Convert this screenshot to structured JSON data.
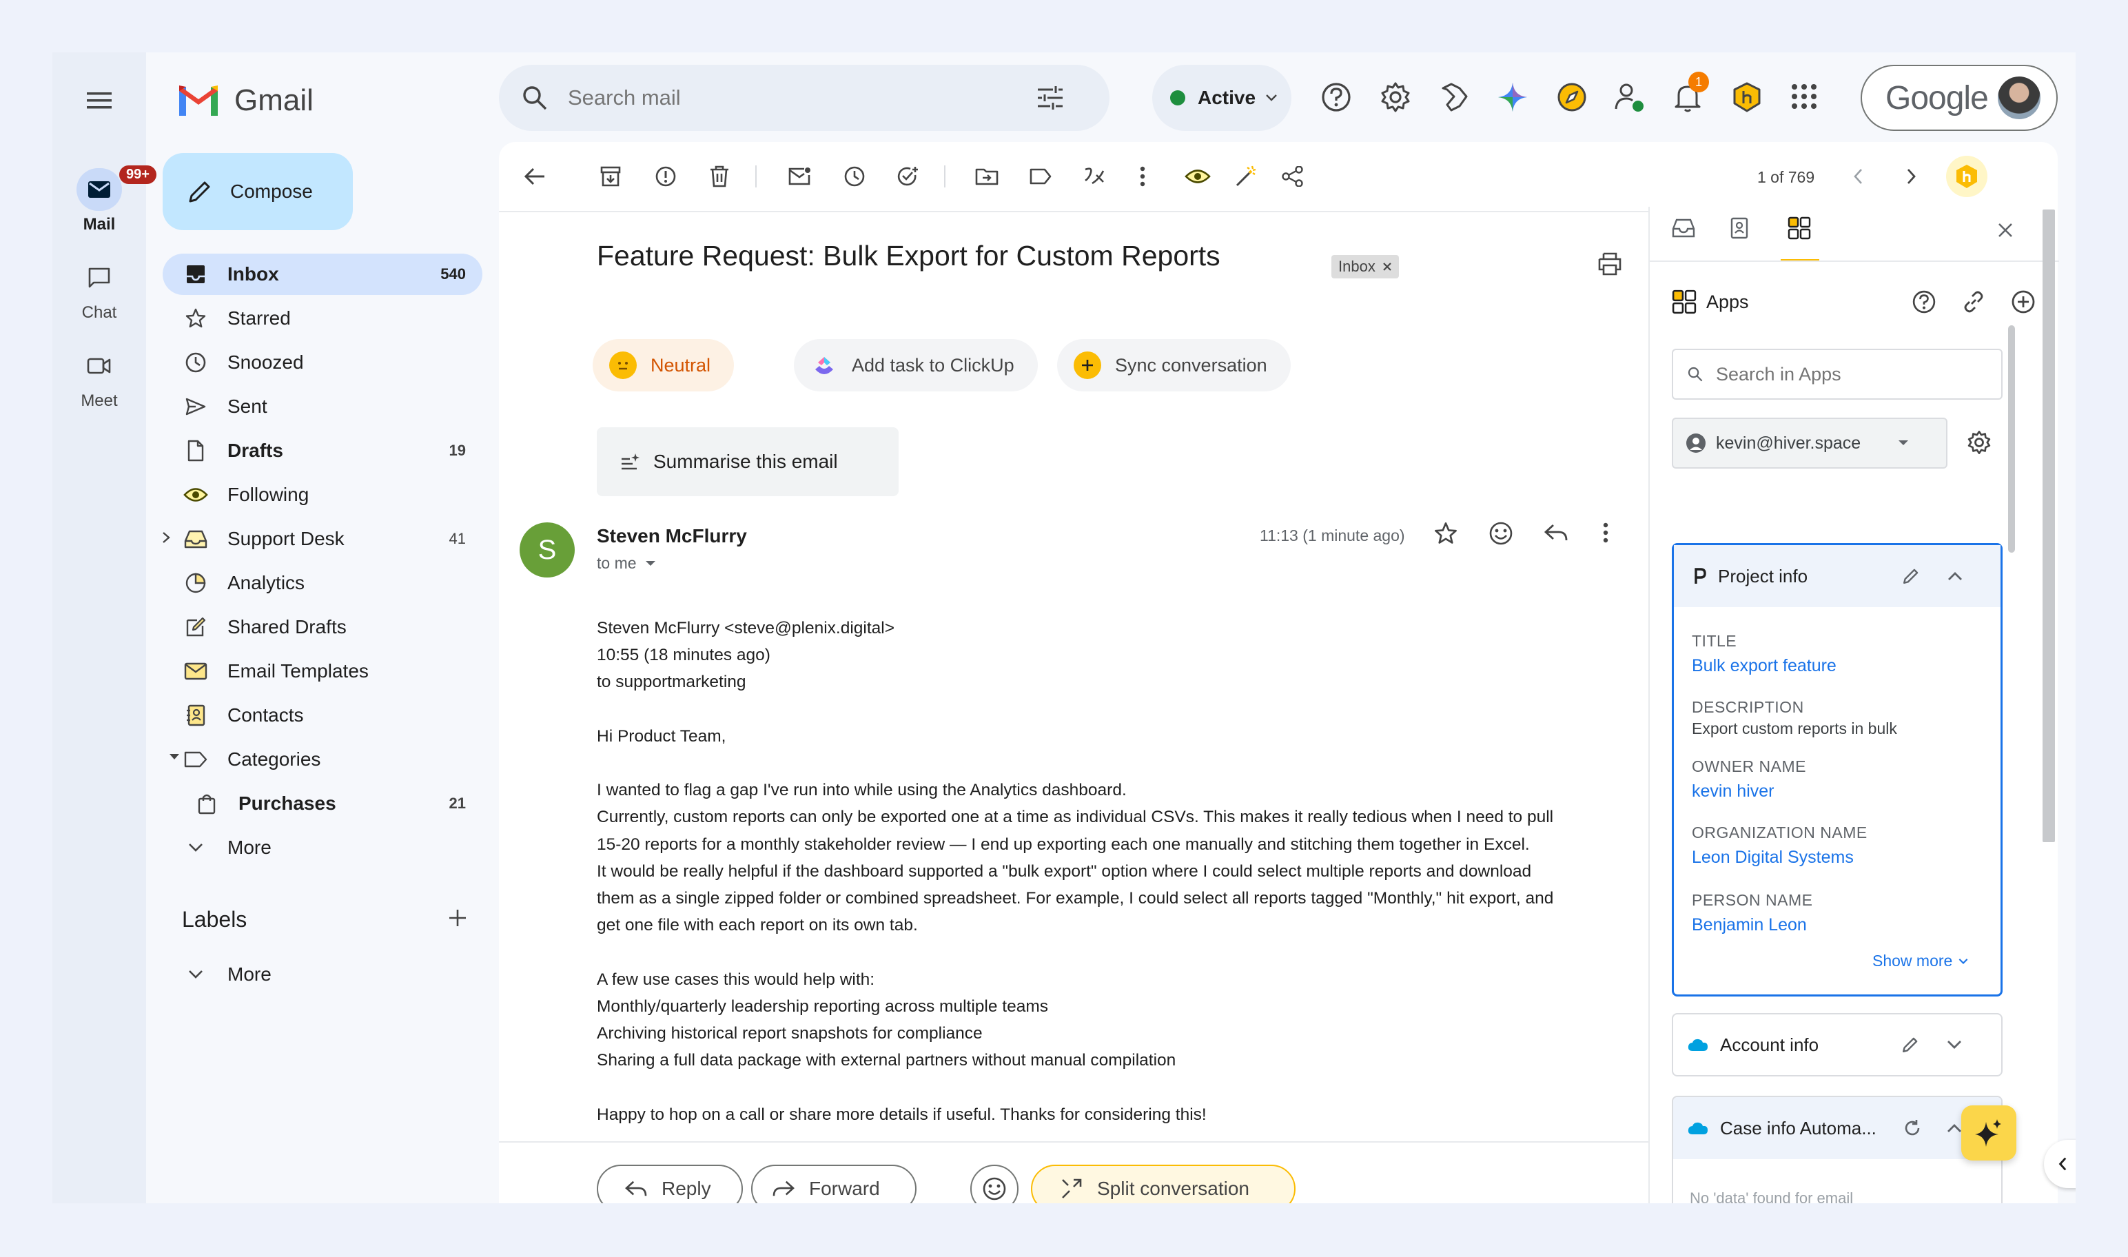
{
  "rail": {
    "mail_label": "Mail",
    "mail_badge": "99+",
    "chat_label": "Chat",
    "meet_label": "Meet"
  },
  "brand": {
    "name": "Gmail"
  },
  "compose": {
    "label": "Compose"
  },
  "nav": {
    "items": [
      {
        "label": "Inbox",
        "count": "540"
      },
      {
        "label": "Starred",
        "count": ""
      },
      {
        "label": "Snoozed",
        "count": ""
      },
      {
        "label": "Sent",
        "count": ""
      },
      {
        "label": "Drafts",
        "count": "19"
      },
      {
        "label": "Following",
        "count": ""
      },
      {
        "label": "Support Desk",
        "count": "41"
      },
      {
        "label": "Analytics",
        "count": ""
      },
      {
        "label": "Shared Drafts",
        "count": ""
      },
      {
        "label": "Email Templates",
        "count": ""
      },
      {
        "label": "Contacts",
        "count": ""
      },
      {
        "label": "Categories",
        "count": ""
      },
      {
        "label": "Purchases",
        "count": "21"
      },
      {
        "label": "More",
        "count": ""
      }
    ],
    "labels_heading": "Labels",
    "labels_more": "More"
  },
  "search": {
    "placeholder": "Search mail"
  },
  "status": {
    "label": "Active"
  },
  "notifications": {
    "count": "1"
  },
  "account": {
    "label": "Google"
  },
  "toolbar": {
    "pagination": "1 of 769"
  },
  "email": {
    "subject": "Feature Request: Bulk Export for Custom Reports",
    "label_chip": "Inbox",
    "chips": {
      "neutral": "Neutral",
      "clickup": "Add task to ClickUp",
      "sync": "Sync conversation"
    },
    "summarise": "Summarise this email",
    "avatar_letter": "S",
    "sender": "Steven McFlurry",
    "to": "to me",
    "time": "11:13 (1 minute ago)",
    "body_lines": [
      "Steven McFlurry <steve@plenix.digital>",
      "10:55 (18 minutes ago)",
      "to supportmarketing",
      "",
      "Hi Product Team,",
      "",
      "I wanted to flag a gap I've run into while using the Analytics dashboard.",
      "Currently, custom reports can only be exported one at a time as individual CSVs. This makes it really tedious when I need to pull",
      "15-20 reports for a monthly stakeholder review — I end up exporting each one manually and stitching them together in Excel.",
      "It would be really helpful if the dashboard supported a \"bulk export\" option where I could select multiple reports and download",
      "them as a single zipped folder or combined spreadsheet. For example, I could select all reports tagged \"Monthly,\" hit export, and",
      "get one file with each report on its own tab.",
      "",
      "A few use cases this would help with:",
      "Monthly/quarterly leadership reporting across multiple teams",
      "Archiving historical report snapshots for compliance",
      "Sharing a full data package with external partners without manual compilation",
      "",
      "Happy to hop on a call or share more details if useful. Thanks for considering this!"
    ],
    "actions": {
      "reply": "Reply",
      "forward": "Forward",
      "split": "Split conversation"
    }
  },
  "side": {
    "apps_title": "Apps",
    "search_placeholder": "Search in Apps",
    "account_email": "kevin@hiver.space",
    "project": {
      "title": "Project info",
      "fields": [
        {
          "label": "TITLE",
          "value": "Bulk export feature"
        },
        {
          "label": "DESCRIPTION",
          "value": "Export custom reports in bulk"
        },
        {
          "label": "OWNER NAME",
          "value": "kevin hiver"
        },
        {
          "label": "ORGANIZATION NAME",
          "value": "Leon Digital Systems"
        },
        {
          "label": "PERSON NAME",
          "value": "Benjamin Leon"
        }
      ],
      "show_more": "Show more"
    },
    "account_info": "Account info",
    "case_info": "Case info Automa...",
    "case_empty": "No 'data' found for email"
  }
}
